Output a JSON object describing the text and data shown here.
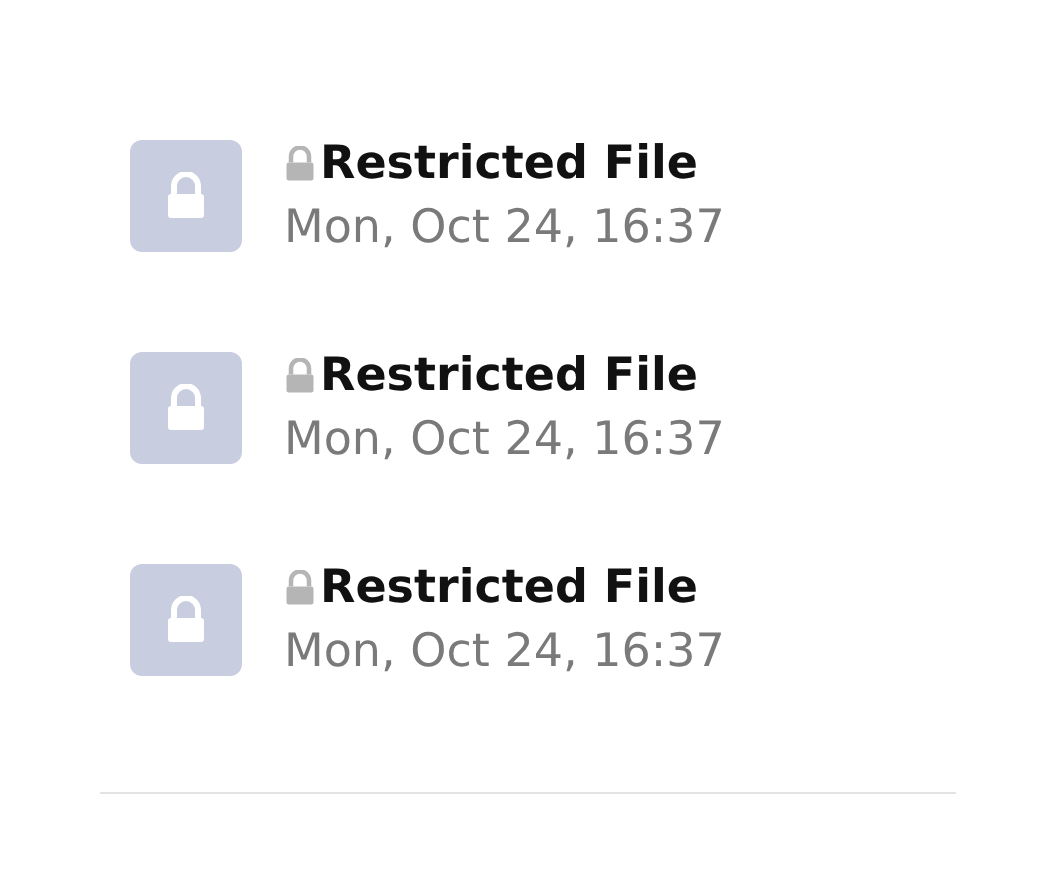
{
  "files": [
    {
      "title": "Restricted File",
      "date": "Mon, Oct 24, 16:37"
    },
    {
      "title": "Restricted File",
      "date": "Mon, Oct 24, 16:37"
    },
    {
      "title": "Restricted File",
      "date": "Mon, Oct 24, 16:37"
    }
  ]
}
